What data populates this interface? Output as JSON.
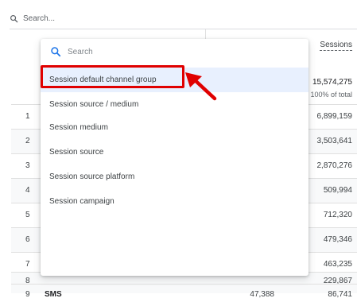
{
  "search": {
    "placeholder": "Search..."
  },
  "table": {
    "column_header": "Sessions",
    "total_value": "15,574,275",
    "total_sub": "100% of total",
    "rows": [
      {
        "index": "1",
        "name": "",
        "users": "",
        "sessions": "6,899,159"
      },
      {
        "index": "2",
        "name": "",
        "users": "",
        "sessions": "3,503,641"
      },
      {
        "index": "3",
        "name": "",
        "users": "",
        "sessions": "2,870,276"
      },
      {
        "index": "4",
        "name": "",
        "users": "",
        "sessions": "509,994"
      },
      {
        "index": "5",
        "name": "",
        "users": "",
        "sessions": "712,320"
      },
      {
        "index": "6",
        "name": "",
        "users": "",
        "sessions": "479,346"
      },
      {
        "index": "7",
        "name": "",
        "users": "",
        "sessions": "463,235"
      },
      {
        "index": "8",
        "name": "",
        "users": "",
        "sessions": "229,867"
      },
      {
        "index": "9",
        "name": "SMS",
        "users": "47,388",
        "sessions": "86,741"
      }
    ]
  },
  "dropdown": {
    "search_placeholder": "Search",
    "items": [
      "Session default channel group",
      "Session source / medium",
      "Session medium",
      "Session source",
      "Session source platform",
      "Session campaign"
    ],
    "selected_index": 0
  },
  "colors": {
    "accent": "#1a73e8",
    "highlight": "#e00000",
    "selected_bg": "#e8f0fe"
  }
}
